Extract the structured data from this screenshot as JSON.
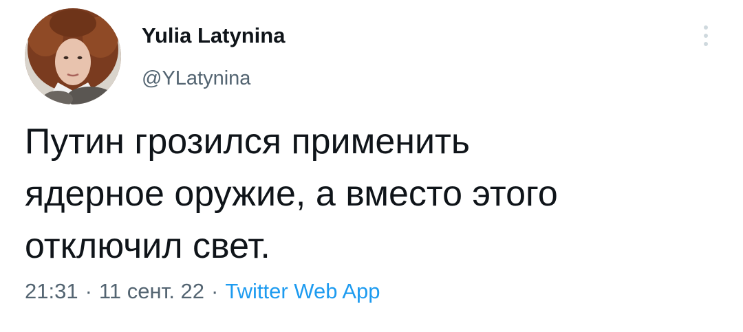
{
  "author": {
    "name": "Yulia Latynina",
    "handle": "@YLatynina"
  },
  "tweet": {
    "lines": [
      "Путин грозился применить",
      "ядерное оружие, а вместо этого",
      "отключил свет."
    ]
  },
  "meta": {
    "time": "21:31",
    "separator": "·",
    "date": "11 сент. 22",
    "source": "Twitter Web App"
  },
  "icons": {
    "more": "vertical-ellipsis-icon"
  },
  "colors": {
    "text": "#0f1419",
    "secondary": "#536471",
    "link": "#1d9bf0"
  }
}
